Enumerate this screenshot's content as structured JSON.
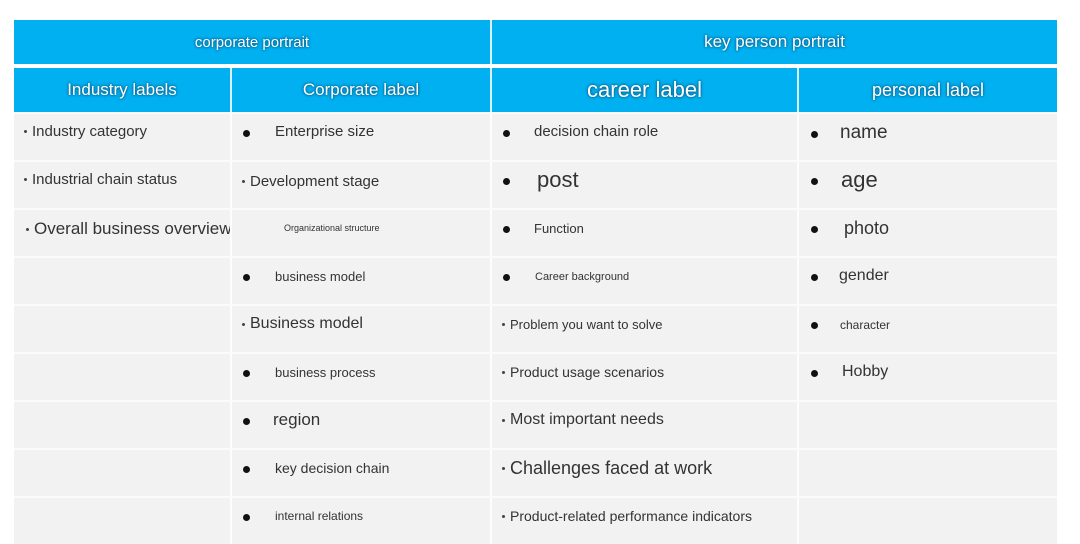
{
  "header": {
    "group_corporate": "corporate portrait",
    "group_person": "key person portrait",
    "industry": "Industry labels",
    "corporate": "Corporate label",
    "career": "career label",
    "personal": "personal label"
  },
  "colors": {
    "header_bg": "#00b0f0",
    "cell_bg": "#f2f2f2"
  },
  "industry_labels": [
    "Industry category",
    "Industrial chain status",
    "Overall business overview"
  ],
  "corporate_labels": [
    "Enterprise size",
    "Development stage",
    "Organizational structure",
    "business model",
    "Business model",
    "business process",
    "region",
    "key decision chain",
    "internal relations"
  ],
  "career_labels": [
    "decision chain role",
    "post",
    "Function",
    "Career background",
    "Problem you want to solve",
    "Product usage scenarios",
    "Most important needs",
    "Challenges faced at work",
    "Product-related performance indicators"
  ],
  "personal_labels": [
    "name",
    "age",
    "photo",
    "gender",
    "character",
    "Hobby"
  ]
}
